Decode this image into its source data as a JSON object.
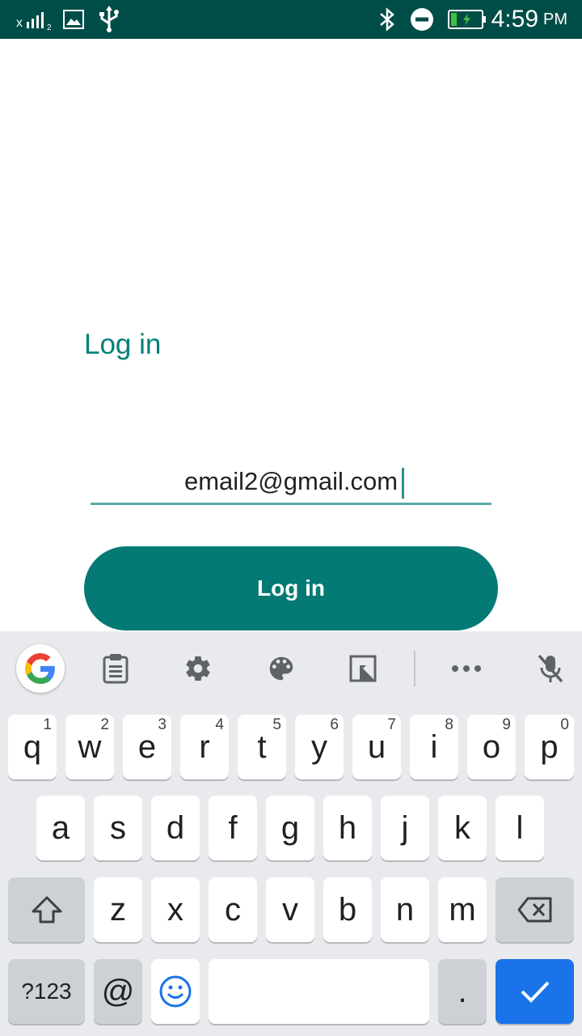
{
  "status_bar": {
    "time": "4:59",
    "ampm": "PM",
    "sim_label": "2"
  },
  "screen": {
    "title": "Log in",
    "email_value": "email2@gmail.com",
    "login_button": "Log in"
  },
  "keyboard": {
    "toolbar": [
      "clipboard-icon",
      "settings-icon",
      "theme-palette-icon",
      "resize-icon",
      "more-icon",
      "mic-off-icon"
    ],
    "row1": [
      {
        "k": "q",
        "h": "1"
      },
      {
        "k": "w",
        "h": "2"
      },
      {
        "k": "e",
        "h": "3"
      },
      {
        "k": "r",
        "h": "4"
      },
      {
        "k": "t",
        "h": "5"
      },
      {
        "k": "y",
        "h": "6"
      },
      {
        "k": "u",
        "h": "7"
      },
      {
        "k": "i",
        "h": "8"
      },
      {
        "k": "o",
        "h": "9"
      },
      {
        "k": "p",
        "h": "0"
      }
    ],
    "row2": [
      "a",
      "s",
      "d",
      "f",
      "g",
      "h",
      "j",
      "k",
      "l"
    ],
    "row3": [
      "z",
      "x",
      "c",
      "v",
      "b",
      "n",
      "m"
    ],
    "symbols_key": "?123",
    "at_key": "@",
    "period_key": ".",
    "colors": {
      "accent": "#1a73e8",
      "brand": "#047a74",
      "statusbar": "#004d47"
    }
  }
}
